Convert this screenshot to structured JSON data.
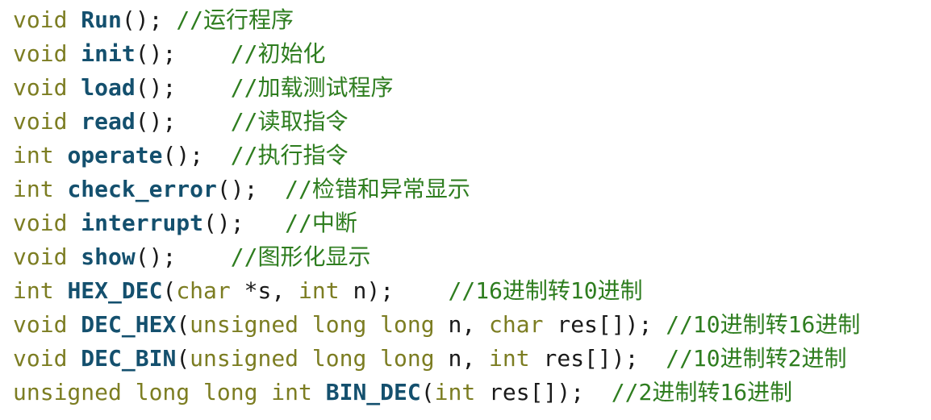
{
  "colors": {
    "keyword": "#7c7d22",
    "function": "#14506e",
    "punctuation": "#1a1a1a",
    "comment": "#2e7d1f",
    "background": "#ffffff"
  },
  "lines": [
    {
      "type": "void",
      "name": "Run",
      "params": "",
      "end": ");",
      "gap": " ",
      "comment": "//运行程序"
    },
    {
      "type": "void",
      "name": "init",
      "params": "",
      "end": ");",
      "gap": "    ",
      "comment": "//初始化"
    },
    {
      "type": "void",
      "name": "load",
      "params": "",
      "end": ");",
      "gap": "    ",
      "comment": "//加载测试程序"
    },
    {
      "type": "void",
      "name": "read",
      "params": "",
      "end": ");",
      "gap": "    ",
      "comment": "//读取指令"
    },
    {
      "type": "int",
      "name": "operate",
      "params": "",
      "end": ");",
      "gap": "  ",
      "comment": "//执行指令"
    },
    {
      "type": "int",
      "name": "check_error",
      "params": "",
      "end": ");",
      "gap": "  ",
      "comment": "//检错和异常显示"
    },
    {
      "type": "void",
      "name": "interrupt",
      "params": "",
      "end": ");",
      "gap": "   ",
      "comment": "//中断"
    },
    {
      "type": "void",
      "name": "show",
      "params": "",
      "end": ");",
      "gap": "    ",
      "comment": "//图形化显示"
    },
    {
      "type": "int",
      "name": "HEX_DEC",
      "params_parts": [
        {
          "k": "char"
        },
        {
          "p": " *s, "
        },
        {
          "k": "int"
        },
        {
          "p": " n"
        }
      ],
      "end": ");",
      "gap": "    ",
      "comment": "//16进制转10进制"
    },
    {
      "type": "void",
      "name": "DEC_HEX",
      "params_parts": [
        {
          "k": "unsigned long long"
        },
        {
          "p": " n, "
        },
        {
          "k": "char"
        },
        {
          "p": " res[]"
        }
      ],
      "end": ");",
      "gap": " ",
      "comment": "//10进制转16进制"
    },
    {
      "type": "void",
      "name": "DEC_BIN",
      "params_parts": [
        {
          "k": "unsigned long long"
        },
        {
          "p": " n, "
        },
        {
          "k": "int"
        },
        {
          "p": " res[]"
        }
      ],
      "end": ");",
      "gap": "  ",
      "comment": "//10进制转2进制"
    },
    {
      "type": "unsigned long long int",
      "name": "BIN_DEC",
      "params_parts": [
        {
          "k": "int"
        },
        {
          "p": " res[]"
        }
      ],
      "end": ");",
      "gap": "  ",
      "comment": "//2进制转16进制"
    }
  ]
}
